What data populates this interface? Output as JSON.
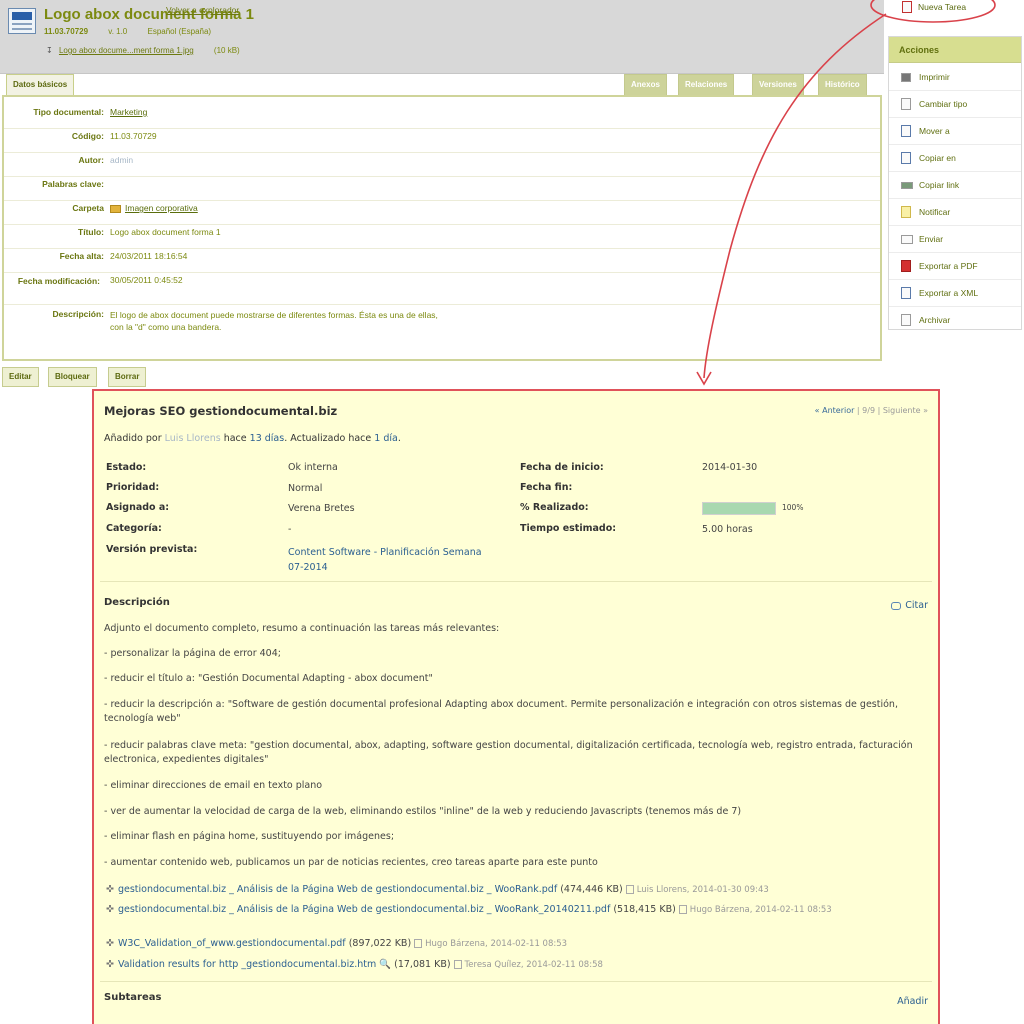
{
  "document": {
    "title": "Logo abox document forma 1",
    "code": "11.03.70729",
    "version": "v. 1.0",
    "language": "Español (España)",
    "file_name": "Logo abox docume...ment forma 1.jpg",
    "file_size": "(10 kB)",
    "tabs": [
      {
        "label": "Datos básicos"
      },
      {
        "label": "Anexos"
      },
      {
        "label": "Relaciones"
      },
      {
        "label": "Versiones"
      },
      {
        "label": "Histórico"
      }
    ],
    "fields": [
      {
        "label": "Tipo documental:",
        "value": "Marketing"
      },
      {
        "label": "Código:",
        "value": "11.03.70729"
      },
      {
        "label": "Autor:",
        "value": "admin"
      },
      {
        "label": "Palabras clave:",
        "value": ""
      },
      {
        "label": "Carpeta",
        "value": "Imagen corporativa"
      },
      {
        "label": "Título:",
        "value": "Logo abox document forma 1"
      },
      {
        "label": "Fecha alta:",
        "value": "24/03/2011 18:16:54"
      },
      {
        "label": "Fecha modificación:",
        "value": "30/05/2011 0:45:52"
      },
      {
        "label": "Descripción:",
        "value": "El logo de abox document puede mostrarse de diferentes formas. Ésta es una de ellas, con la \"d\" como una bandera."
      }
    ],
    "buttons": {
      "edit": "Editar",
      "lock": "Bloquear",
      "delete": "Borrar",
      "back": "Volver a explorador"
    }
  },
  "sidebar": {
    "new_task": "Nueva Tarea",
    "actions_title": "Acciones",
    "actions": [
      {
        "label": "Imprimir",
        "icon": "printer-icon"
      },
      {
        "label": "Cambiar tipo",
        "icon": "document-icon"
      },
      {
        "label": "Mover a",
        "icon": "move-icon"
      },
      {
        "label": "Copiar en",
        "icon": "copy-icon"
      },
      {
        "label": "Copiar link",
        "icon": "link-icon"
      },
      {
        "label": "Notificar",
        "icon": "notify-icon"
      },
      {
        "label": "Enviar",
        "icon": "mail-icon"
      },
      {
        "label": "Exportar a PDF",
        "icon": "pdf-icon"
      },
      {
        "label": "Exportar a XML",
        "icon": "xml-icon"
      },
      {
        "label": "Archivar",
        "icon": "archive-icon"
      }
    ]
  },
  "task": {
    "title": "Mejoras SEO gestiondocumental.biz",
    "nav": {
      "prev": "« Anterior",
      "counter": "9/9",
      "next": "Siguiente »"
    },
    "added_prefix": "Añadido por",
    "added_by": "Luis Llorens",
    "added_mid": "hace",
    "added_ago": "13 días",
    "updated_prefix": ". Actualizado hace",
    "updated_ago": "1 día",
    "attributes_left": [
      {
        "label": "Estado:",
        "value": "Ok interna"
      },
      {
        "label": "Prioridad:",
        "value": "Normal"
      },
      {
        "label": "Asignado a:",
        "value": "Verena Bretes"
      },
      {
        "label": "Categoría:",
        "value": "-"
      },
      {
        "label": "Versión prevista:",
        "value": "Content Software - Planificación Semana 07-2014"
      }
    ],
    "attributes_right": [
      {
        "label": "Fecha de inicio:",
        "value": "2014-01-30"
      },
      {
        "label": "Fecha fin:",
        "value": ""
      },
      {
        "label": "% Realizado:",
        "value": "100%"
      },
      {
        "label": "Tiempo estimado:",
        "value": "5.00 horas"
      }
    ],
    "progress": 1.0,
    "description_title": "Descripción",
    "cite_label": "Citar",
    "description": [
      "Adjunto el documento completo, resumo a continuación las tareas más relevantes:",
      "- personalizar la página de error 404;",
      "- reducir el título a: \"Gestión Documental Adapting - abox document\"",
      "- reducir la descripción a: \"Software de gestión documental profesional Adapting abox document. Permite personalización e integración con otros sistemas de gestión, tecnología web\"",
      "- reducir palabras clave meta: \"gestion documental, abox, adapting, software gestion documental, digitalización certificada, tecnología web, registro entrada, facturación electronica, expedientes digitales\"",
      "- eliminar direcciones de email en texto plano",
      "- ver de aumentar la velocidad de carga de la web, eliminando estilos \"inline\" de la web y reduciendo Javascripts (tenemos más de 7)",
      "- eliminar flash en página home, sustituyendo por imágenes;",
      "- aumentar contenido web, publicamos un par de noticias recientes, creo tareas aparte para este punto"
    ],
    "attachments": [
      {
        "name": "gestiondocumental.biz _ Análisis de la Página Web de gestiondocumental.biz _ WooRank.pdf",
        "size": "(474,446 KB)",
        "meta": "Luis Llorens, 2014-01-30 09:43"
      },
      {
        "name": "gestiondocumental.biz _ Análisis de la Página Web de gestiondocumental.biz _ WooRank_20140211.pdf",
        "size": "(518,415 KB)",
        "meta": "Hugo Bárzena, 2014-02-11 08:53"
      },
      {
        "name": "W3C_Validation_of_www.gestiondocumental.pdf",
        "size": "(897,022 KB)",
        "meta": "Hugo Bárzena, 2014-02-11 08:53"
      },
      {
        "name": "Validation results for http _gestiondocumental.biz.htm",
        "size": "(17,081 KB)",
        "meta": "Teresa Quílez, 2014-02-11 08:58"
      }
    ],
    "subtasks_title": "Subtareas",
    "add_label": "Añadir"
  },
  "colors": {
    "accent_olive": "#7c8a10",
    "task_bg": "#ffffd6",
    "annotation_red": "#e0525a",
    "link_blue": "#2b5f91"
  }
}
